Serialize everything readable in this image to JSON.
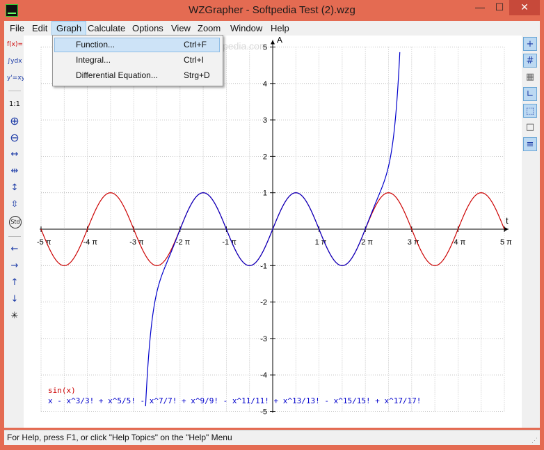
{
  "titlebar": {
    "title": "WZGrapher - Softpedia Test (2).wzg",
    "minimize": "—",
    "maximize": "☐",
    "close": "✕"
  },
  "menubar": {
    "items": [
      "File",
      "Edit",
      "Graph",
      "Calculate",
      "Options",
      "View",
      "Zoom",
      "Window",
      "Help"
    ],
    "active": "Graph"
  },
  "graph_menu": {
    "items": [
      {
        "label": "Function...",
        "shortcut": "Ctrl+F"
      },
      {
        "label": "Integral...",
        "shortcut": "Ctrl+I"
      },
      {
        "label": "Differential Equation...",
        "shortcut": "Strg+D"
      }
    ]
  },
  "left_toolbar": {
    "tools": [
      {
        "name": "function-tool-icon",
        "glyph": "f(x)="
      },
      {
        "name": "integral-tool-icon",
        "glyph": "∫ydx"
      },
      {
        "name": "differential-tool-icon",
        "glyph": "y'=xy"
      },
      {
        "name": "zoom-1-1-icon",
        "glyph": "1:1"
      },
      {
        "name": "zoom-in-icon",
        "glyph": "⊕"
      },
      {
        "name": "zoom-out-icon",
        "glyph": "⊖"
      },
      {
        "name": "stretch-x-icon",
        "glyph": "↔"
      },
      {
        "name": "shrink-x-icon",
        "glyph": "⇹"
      },
      {
        "name": "stretch-y-icon",
        "glyph": "↕"
      },
      {
        "name": "shrink-y-icon",
        "glyph": "⇳"
      },
      {
        "name": "standard-zoom-icon",
        "glyph": "Std"
      },
      {
        "name": "pan-left-icon",
        "glyph": "←"
      },
      {
        "name": "pan-right-icon",
        "glyph": "→"
      },
      {
        "name": "pan-up-icon",
        "glyph": "↑"
      },
      {
        "name": "pan-down-icon",
        "glyph": "↓"
      },
      {
        "name": "center-icon",
        "glyph": "✳"
      }
    ]
  },
  "right_toolbar": {
    "tools": [
      {
        "name": "axes-toggle-icon",
        "glyph": "+",
        "on": true
      },
      {
        "name": "grid-toggle-icon",
        "glyph": "#",
        "on": true
      },
      {
        "name": "fine-grid-icon",
        "glyph": "▦",
        "on": false
      },
      {
        "name": "frame-axes-icon",
        "glyph": "∟",
        "on": true
      },
      {
        "name": "dotted-frame-icon",
        "glyph": "⬚",
        "on": true
      },
      {
        "name": "border-icon",
        "glyph": "□",
        "on": false
      },
      {
        "name": "legend-toggle-icon",
        "glyph": "≡",
        "on": true
      }
    ]
  },
  "graph": {
    "x_axis_label": "t",
    "y_axis_label": "A",
    "x_ticks": [
      "-5 π",
      "-4 π",
      "-3 π",
      "-2 π",
      "-1 π",
      "1 π",
      "2 π",
      "3 π",
      "4 π",
      "5 π"
    ],
    "y_ticks": [
      "5",
      "4",
      "3",
      "2",
      "1",
      "-1",
      "-2",
      "-3",
      "-4",
      "-5"
    ],
    "x_range_pi": [
      -5,
      5
    ],
    "y_range": [
      -5,
      5
    ],
    "grid": true,
    "watermark": "www.softpedia.com",
    "colors": {
      "sin": "#cc0000",
      "series": "#0000cc",
      "axis": "#000000",
      "grid": "#b0b0b0"
    },
    "legend": [
      {
        "text": "sin(x)",
        "color": "#cc0000"
      },
      {
        "text": "x - x^3/3! + x^5/5! - x^7/7! + x^9/9! - x^11/11! + x^13/13! - x^15/15! + x^17/17!",
        "color": "#0000cc"
      }
    ]
  },
  "statusbar": {
    "text": "For Help, press F1, or click \"Help Topics\" on the \"Help\" Menu"
  }
}
